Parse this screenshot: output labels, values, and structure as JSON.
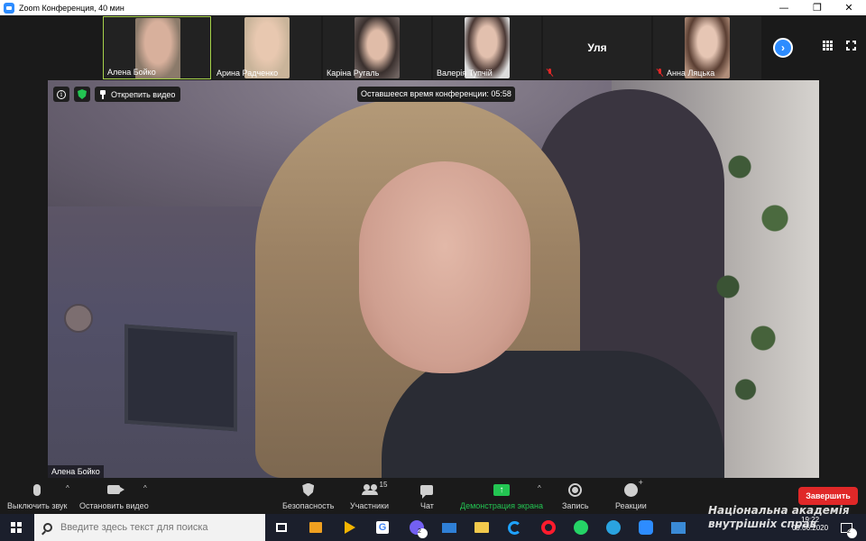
{
  "window": {
    "title": "Zoom Конференция, 40 мин",
    "minimize": "—",
    "maximize": "❐",
    "close": "✕"
  },
  "thumbnails": [
    {
      "name": "Алена Бойко",
      "muted": false,
      "active": true,
      "color": "#8b7a6a"
    },
    {
      "name": "Арина Радченко",
      "muted": false,
      "active": false,
      "color": "#c9b49a"
    },
    {
      "name": "Каріна Ругаль",
      "muted": false,
      "active": false,
      "color": "#6f6360"
    },
    {
      "name": "Валерія Тупчій",
      "muted": false,
      "active": false,
      "color": "#a08478"
    },
    {
      "name": "Уля",
      "muted": true,
      "active": false,
      "video": false
    },
    {
      "name": "Анна Ляцька",
      "muted": true,
      "active": false,
      "color": "#b08e7a"
    }
  ],
  "main_video": {
    "speaker": "Алена Бойко",
    "unpin_label": "Открепить видео",
    "time_remaining": "Оставшееся время конференции: 05:58"
  },
  "toolbar": {
    "mute_label": "Выключить звук",
    "video_label": "Остановить видео",
    "security_label": "Безопасность",
    "participants_label": "Участники",
    "participants_count": "15",
    "chat_label": "Чат",
    "share_label": "Демонстрация экрана",
    "record_label": "Запись",
    "reactions_label": "Реакции",
    "end_label": "Завершить"
  },
  "taskbar": {
    "search_placeholder": "Введите здесь текст для поиска",
    "viber_badge": "2",
    "time": "19:22",
    "date": "09.06.2020",
    "notification_count": "2"
  },
  "watermark": {
    "line1": "Національна академія",
    "line2": "внутрішніх справ"
  },
  "colors": {
    "accent": "#2d8cff",
    "end_button": "#e02828",
    "share_green": "#23c552",
    "active_border": "#a6d24a"
  }
}
